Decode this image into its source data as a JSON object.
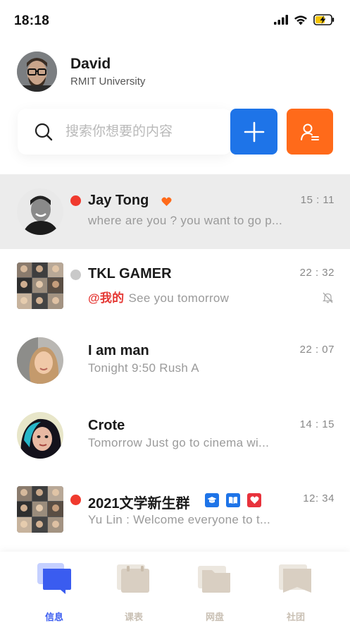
{
  "status_bar": {
    "time": "18:18",
    "icons": [
      "signal-icon",
      "wifi-icon",
      "battery-charging-icon"
    ]
  },
  "profile": {
    "name": "David",
    "organization": "RMIT University"
  },
  "search": {
    "placeholder": "搜索你想要的内容"
  },
  "actions": {
    "add_icon": "plus-icon",
    "contacts_icon": "contact-list-icon"
  },
  "chats": [
    {
      "name": "Jay Tong",
      "time": "15 : 11",
      "message": "where are you ? you want to go p...",
      "status_dot": "#f03a2e",
      "badge": "heart-icon",
      "selected": true
    },
    {
      "name": "TKL GAMER",
      "time": "22 : 32",
      "mention": "@我的",
      "message": "See you tomorrow",
      "status_dot": "#c9c9c9",
      "muted": true
    },
    {
      "name": "I am man",
      "time": "22 : 07",
      "message": "Tonight 9:50  Rush A"
    },
    {
      "name": "Crote",
      "time": "14 : 15",
      "message": "Tomorrow Just go to cinema wi..."
    },
    {
      "name": "2021文学新生群",
      "time": "12: 34",
      "message": "Yu Lin : Welcome  everyone to t...",
      "status_dot": "#f03a2e",
      "badges": [
        "graduation-cap-icon",
        "book-icon",
        "heart-icon"
      ]
    }
  ],
  "tabs": [
    {
      "label": "信息",
      "icon": "chat-bubble-icon",
      "active": true
    },
    {
      "label": "课表",
      "icon": "calendar-icon",
      "active": false
    },
    {
      "label": "网盘",
      "icon": "folder-icon",
      "active": false
    },
    {
      "label": "社团",
      "icon": "bookmark-icon",
      "active": false
    }
  ],
  "colors": {
    "accent_blue": "#1e74e8",
    "accent_orange": "#ff6a1a",
    "unread_red": "#f03a2e",
    "tab_active": "#3a5cf0",
    "tab_inactive": "#c9c0b4"
  }
}
